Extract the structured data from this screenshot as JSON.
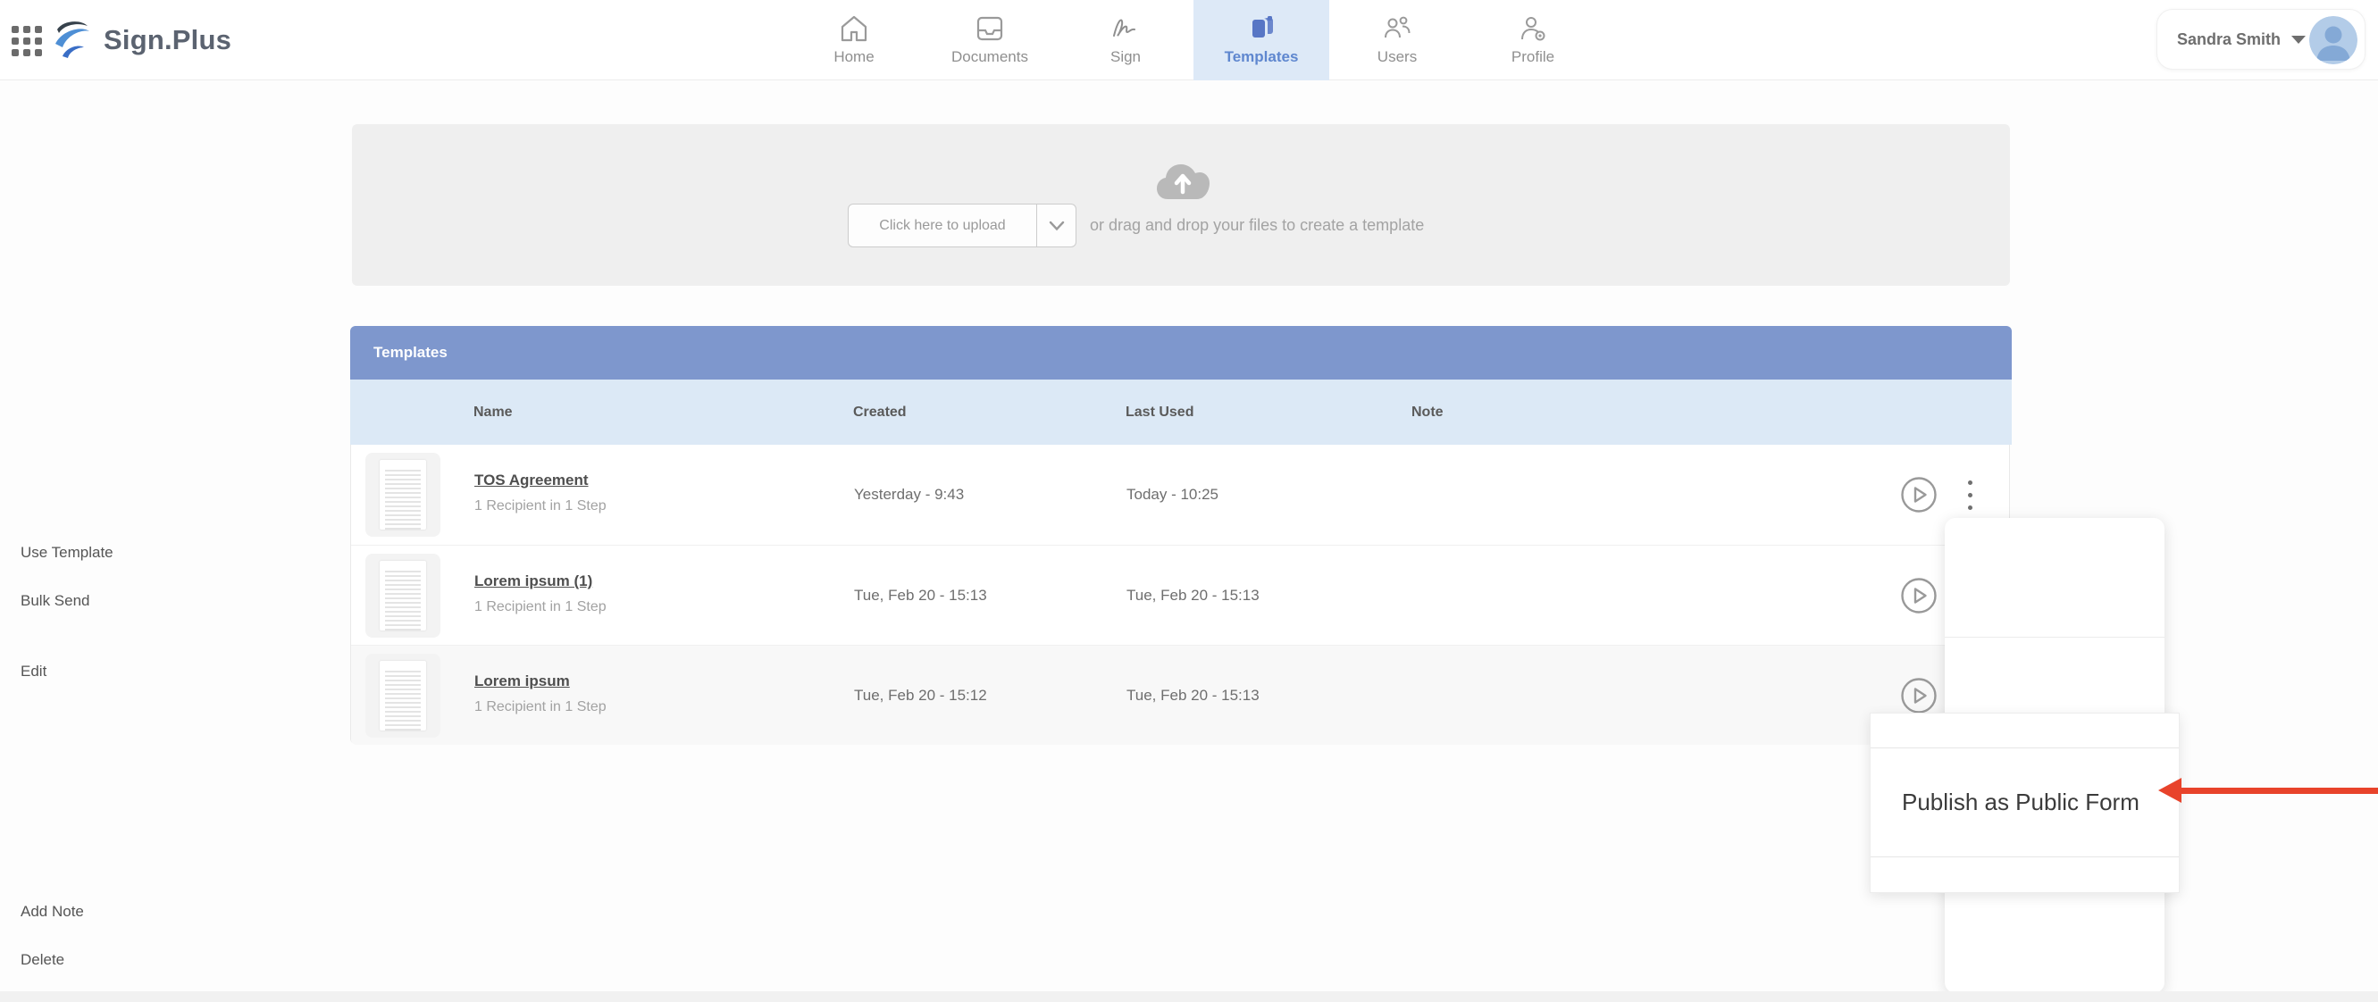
{
  "header": {
    "brand": "Sign.Plus",
    "nav": [
      {
        "label": "Home"
      },
      {
        "label": "Documents"
      },
      {
        "label": "Sign"
      },
      {
        "label": "Templates"
      },
      {
        "label": "Users"
      },
      {
        "label": "Profile"
      }
    ],
    "active_tab": "Templates",
    "user": {
      "name": "Sandra Smith"
    }
  },
  "upload": {
    "button_label": "Click here to upload",
    "hint": "or drag and drop your files to create a template"
  },
  "table": {
    "title": "Templates",
    "columns": [
      "Name",
      "Created",
      "Last Used",
      "Note"
    ],
    "rows": [
      {
        "name": "TOS Agreement",
        "subtitle": "1 Recipient in 1 Step",
        "created": "Yesterday - 9:43",
        "last_used": "Today - 10:25",
        "note": ""
      },
      {
        "name": "Lorem ipsum (1)",
        "subtitle": "1 Recipient in 1 Step",
        "created": "Tue, Feb 20 - 15:13",
        "last_used": "Tue, Feb 20 - 15:13",
        "note": ""
      },
      {
        "name": "Lorem ipsum",
        "subtitle": "1 Recipient in 1 Step",
        "created": "Tue, Feb 20 - 15:12",
        "last_used": "Tue, Feb 20 - 15:13",
        "note": ""
      }
    ]
  },
  "context_menu": {
    "items": [
      "Use Template",
      "Bulk Send",
      "Edit",
      "Publish as Public Form",
      "Add Note",
      "Delete"
    ],
    "highlighted_item": "Publish as Public Form"
  },
  "colors": {
    "accent_blue": "#5f87cf",
    "active_tab_bg": "#dde9f7",
    "table_titlebar": "#7e97cd",
    "table_header_bg": "#dce9f6",
    "arrow_red": "#e8432b"
  }
}
